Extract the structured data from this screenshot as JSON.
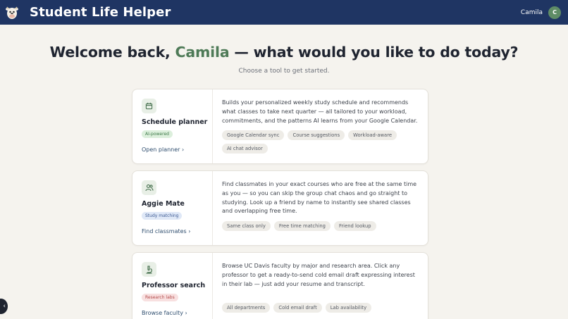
{
  "header": {
    "title": "Student Life Helper",
    "user_name": "Camila",
    "avatar_initial": "C",
    "bg_color": "#1f3563"
  },
  "hero": {
    "welcome_prefix": "Welcome back, ",
    "name": "Camila",
    "welcome_suffix": " — what would you like to do today?",
    "subtitle": "Choose a tool to get started."
  },
  "cards": [
    {
      "icon": "calendar-icon",
      "title": "Schedule planner",
      "badge": "AI-powered",
      "link": "Open planner",
      "description": "Builds your personalized weekly study schedule and recommends what classes to take next quarter — all tailored to your workload, commitments, and the patterns AI learns from your Google Calendar.",
      "tags": [
        "Google Calendar sync",
        "Course suggestions",
        "Workload-aware",
        "AI chat advisor"
      ]
    },
    {
      "icon": "users-icon",
      "title": "Aggie Mate",
      "badge": "Study matching",
      "link": "Find classmates",
      "description": "Find classmates in your exact courses who are free at the same time as you — so you can skip the group chat chaos and go straight to studying. Look up a friend by name to instantly see shared classes and overlapping free time.",
      "tags": [
        "Same class only",
        "Free time matching",
        "Friend lookup"
      ]
    },
    {
      "icon": "microscope-icon",
      "title": "Professor search",
      "badge": "Research labs",
      "link": "Browse faculty",
      "description": "Browse UC Davis faculty by major and research area. Click any professor to get a ready-to-send cold email draft expressing interest in their lab — just add your resume and transcript.",
      "tags": [
        "All departments",
        "Cold email draft",
        "Lab availability"
      ]
    }
  ]
}
